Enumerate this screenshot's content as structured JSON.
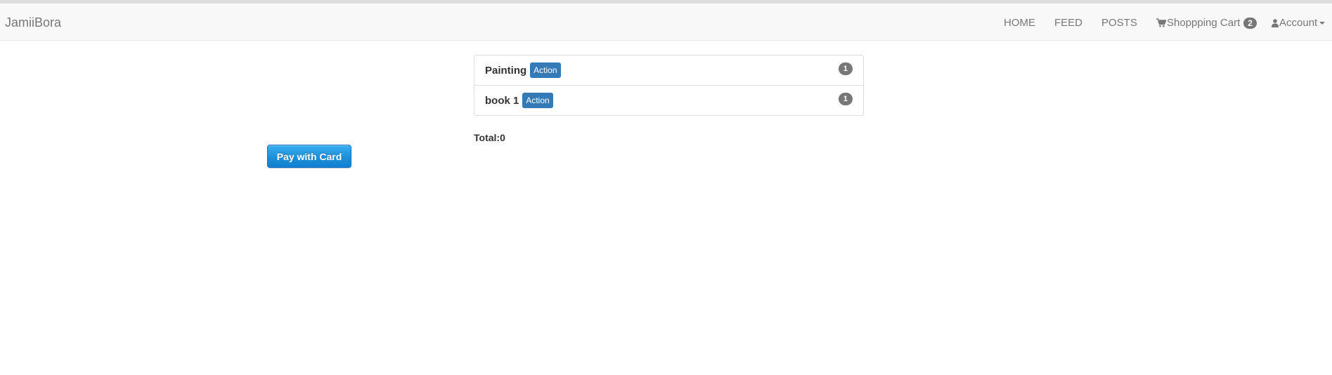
{
  "navbar": {
    "brand": "JamiiBora",
    "links": {
      "home": "HOME",
      "feed": "FEED",
      "posts": "POSTS"
    },
    "cart": {
      "icon": "shopping-cart-icon",
      "label": "Shoppping Cart",
      "count": "2"
    },
    "account": {
      "icon": "user-icon",
      "label": "Account"
    }
  },
  "cart_items": [
    {
      "name": "Painting",
      "action_label": "Action",
      "quantity": "1"
    },
    {
      "name": "book 1",
      "action_label": "Action",
      "quantity": "1"
    }
  ],
  "total_text": "Total:0",
  "pay_button_label": "Pay with Card",
  "colors": {
    "action_label": "#337ab7",
    "badge": "#777777",
    "pay_button": "#1f8fd8"
  }
}
